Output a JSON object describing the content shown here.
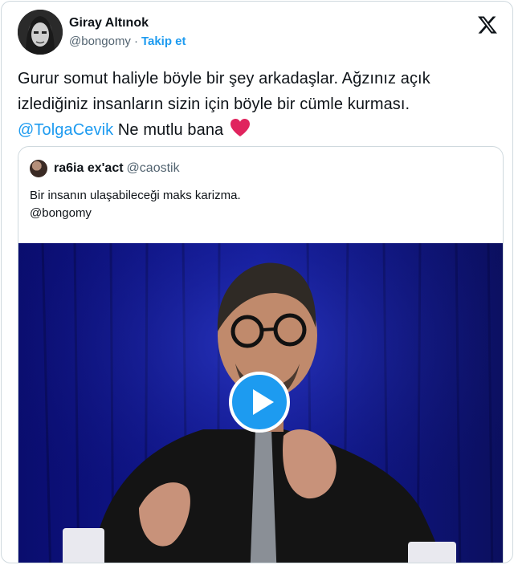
{
  "author": {
    "name": "Giray Altınok",
    "handle": "@bongomy",
    "separator": "·",
    "follow_label": "Takip et",
    "avatar_icon": "profile-photo"
  },
  "logo_icon": "x-logo-icon",
  "tweet": {
    "line1": "Gurur somut haliyle böyle bir şey arkadaşlar. Ağzınız açık",
    "line2": "izlediğiniz insanların sizin için böyle bir cümle kurması.",
    "mention": "@TolgaCevik",
    "tail": " Ne mutlu bana",
    "emoji_icon": "red-heart-icon"
  },
  "quote": {
    "name": "ra6ia ex'act",
    "handle": "@caostik",
    "text_line1": "Bir insanın ulaşabileceği maks karizma.",
    "text_line2": "@bongomy",
    "media_icon": "play-button-icon"
  },
  "colors": {
    "link": "#1d9bf0",
    "text": "#0f1419",
    "muted": "#536471",
    "border": "#cfd9de",
    "heart": "#e0245e",
    "video_bg": "#0b0f5c"
  }
}
